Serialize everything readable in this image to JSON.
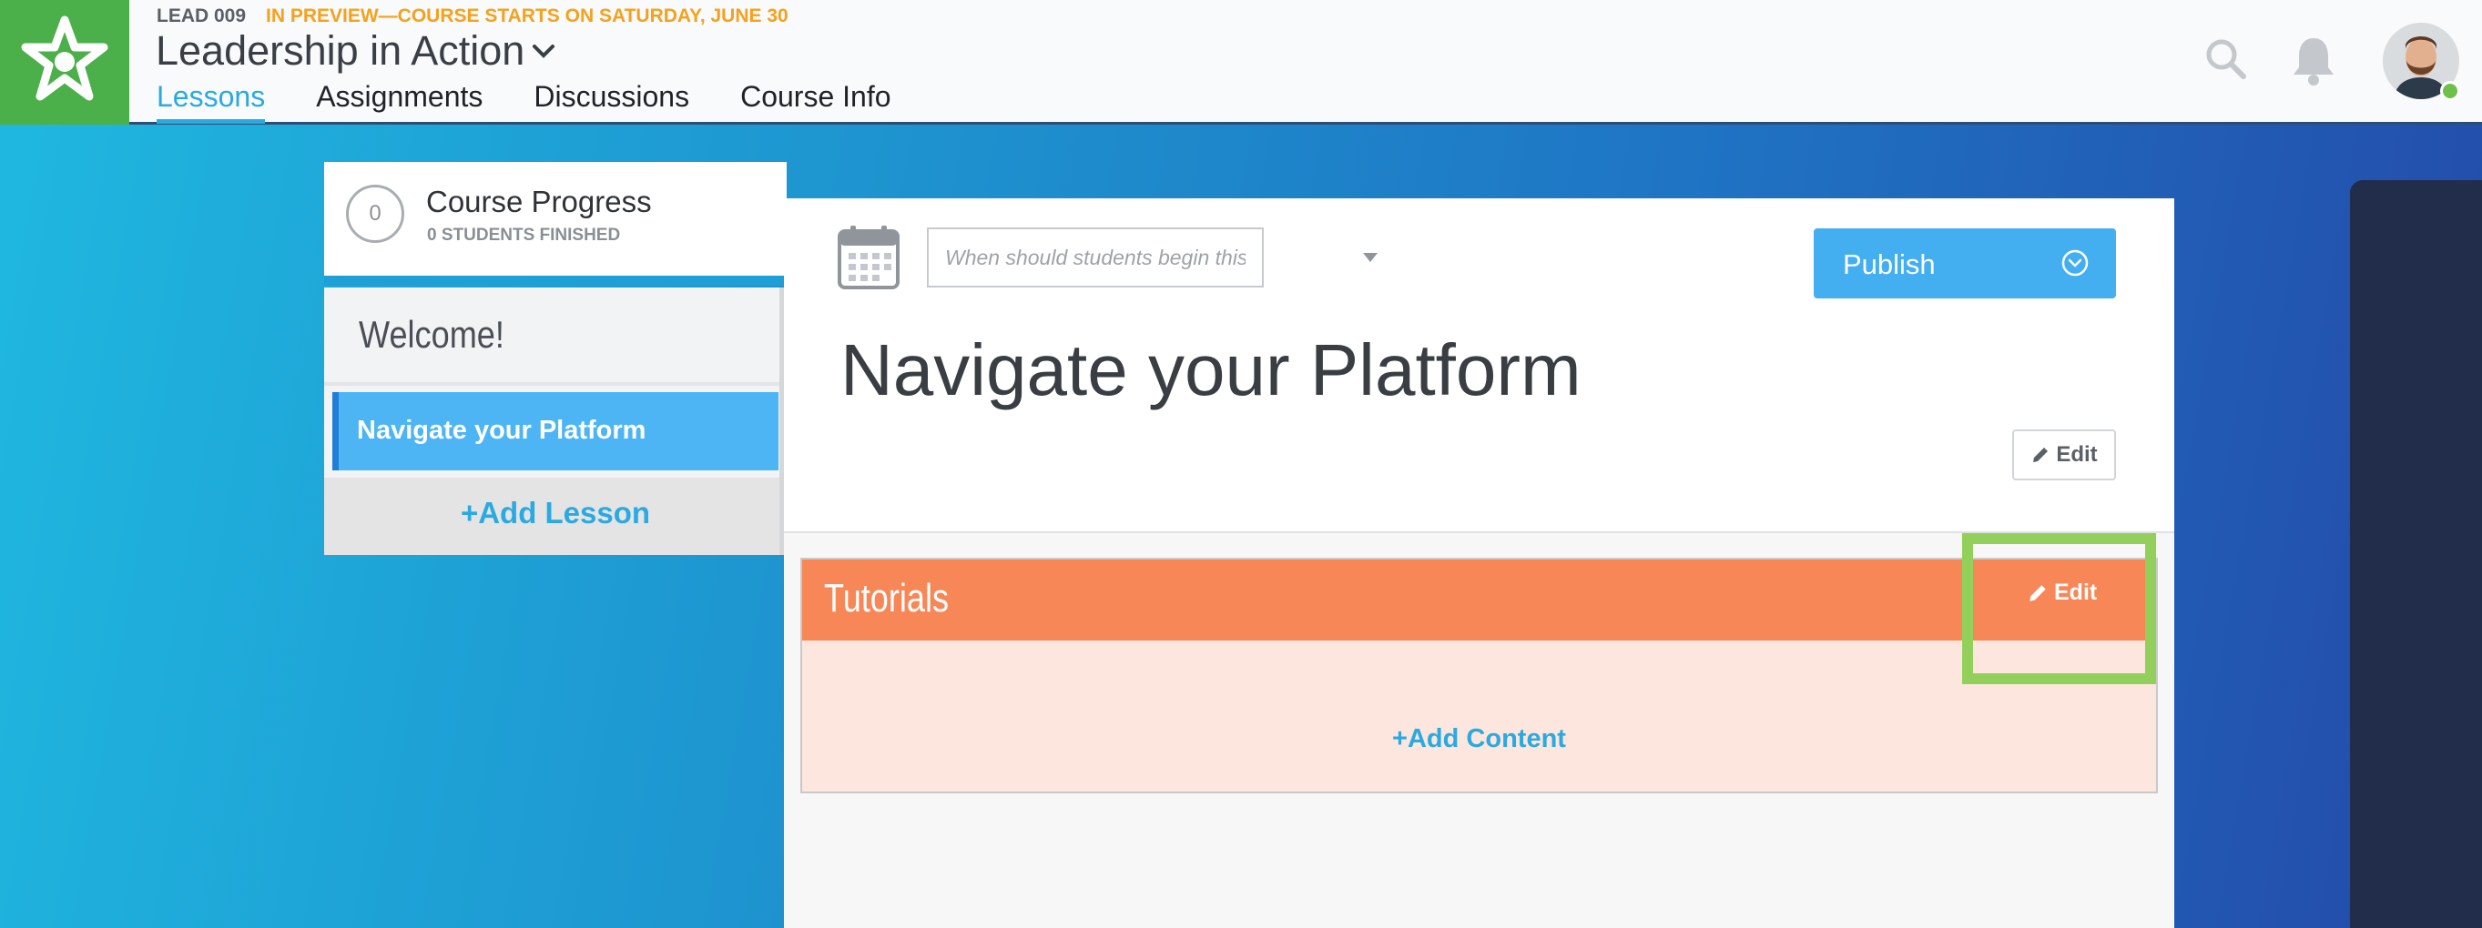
{
  "header": {
    "course_code": "LEAD 009",
    "preview_notice": "IN PREVIEW—COURSE STARTS ON SATURDAY, JUNE 30",
    "course_title": "Leadership in Action",
    "tabs": [
      {
        "label": "Lessons",
        "active": true
      },
      {
        "label": "Assignments",
        "active": false
      },
      {
        "label": "Discussions",
        "active": false
      },
      {
        "label": "Course Info",
        "active": false
      }
    ],
    "icons": {
      "logo": "asterisk-logo-icon",
      "search": "search-icon",
      "notifications": "bell-icon",
      "user": "avatar"
    }
  },
  "sidebar": {
    "progress": {
      "count": "0",
      "title": "Course Progress",
      "subtitle": "0 STUDENTS FINISHED"
    },
    "section_title": "Welcome!",
    "lessons": [
      {
        "label": "Navigate your Platform",
        "selected": true
      }
    ],
    "add_lesson_label": "+Add Lesson"
  },
  "lesson": {
    "date_placeholder": "When should students begin this lesson?",
    "publish_label": "Publish",
    "title": "Navigate your Platform",
    "edit_label": "Edit",
    "section": {
      "name": "Tutorials",
      "edit_label": "Edit",
      "add_content_label": "+Add Content"
    }
  },
  "colors": {
    "brand_green": "#4cb04a",
    "accent_blue": "#2ba9e1",
    "preview_orange": "#f6a11d",
    "section_orange": "#f88757",
    "highlight_green": "#93d05b"
  }
}
